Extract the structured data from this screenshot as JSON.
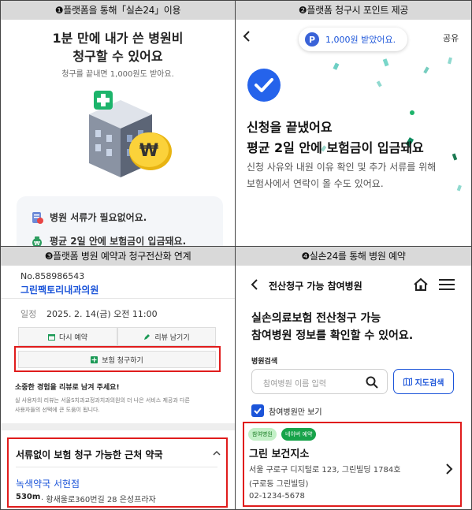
{
  "captions": {
    "c1": "❶플랫폼을 통해「실손24」이용",
    "c2": "❷플랫폼 청구시 포인트 제공",
    "c3": "❸플랫폼 병원 예약과 청구전산화 연계",
    "c4": "❹실손24를 통해 병원 예약"
  },
  "panel1": {
    "title_line1": "1분 만에 내가 쓴 병원비",
    "title_line2": "청구할 수 있어요",
    "subtitle": "청구를 끝내면 1,000원도 받아요.",
    "row1": "병원 서류가 필요없어요.",
    "row2": "평균 2일 안에 보험금이 입금돼요."
  },
  "panel2": {
    "pill_text": "1,000원 받았어요.",
    "share": "공유",
    "heading_line1": "신청을 끝냈어요",
    "heading_line2": "평균 2일 안에 보험금이 입금돼요",
    "desc_line1": "신청 사유와 내원 이유 확인 및 추가 서류를 위해",
    "desc_line2": "보험사에서 연락이 올 수도 있어요."
  },
  "panel3": {
    "number": "No.858986543",
    "clinic": "그린팩토리내과의원",
    "date_label": "일정",
    "date_value": "2025. 2. 14(금) 오전 11:00",
    "rebook": "다시 예약",
    "review": "리뷰 남기기",
    "claim": "보험 청구하기",
    "share_title": "소중한 경험을 리뷰로 남겨 주세요!",
    "share_desc_line1": "실 사용자의 리뷰는 서울S치과교정과치과의원의 더 나은 서비스 제공과 다른",
    "share_desc_line2": "사용자들의 선택에 큰 도움이 됩니다.",
    "pharmacy_header": "서류없이 보험 청구 가능한 근처 약국",
    "pharmacy_name": "녹색약국 서현점",
    "pharmacy_dist": "530m",
    "pharmacy_addr": "· 황새울로360번길 28 은성프라자"
  },
  "panel4": {
    "nav_title": "전산청구 가능 참여병원",
    "heading_line1": "실손의료보험 전산청구 가능",
    "heading_line2": "참여병원 정보를 확인할 수 있어요.",
    "search_label": "병원검색",
    "search_placeholder": "참여병원 이름 입력",
    "map_button": "지도검색",
    "checkbox_label": "참여병원만 보기",
    "tag1": "참여병원",
    "tag2": "네이버 예약",
    "hospital_name": "그린 보건지소",
    "address_line1": "서울 구로구 디지털로 123, 그린빌딩 1784호",
    "address_line2": "(구로동 그린빌딩)",
    "phone": "02-1234-5678"
  },
  "colors": {
    "accent": "#1b54d9",
    "red": "#e01c1c",
    "green": "#17b169",
    "caption_bg": "#d9d9d9"
  },
  "icons": [
    "building-icon",
    "coin-icon",
    "document-icon",
    "money-bag-icon",
    "back-arrow-icon",
    "points-badge-icon",
    "check-circle-icon",
    "calendar-icon",
    "pencil-icon",
    "plus-icon",
    "chevron-up-icon",
    "home-icon",
    "menu-icon",
    "search-icon",
    "map-icon",
    "checkbox-icon",
    "chevron-right-icon"
  ]
}
